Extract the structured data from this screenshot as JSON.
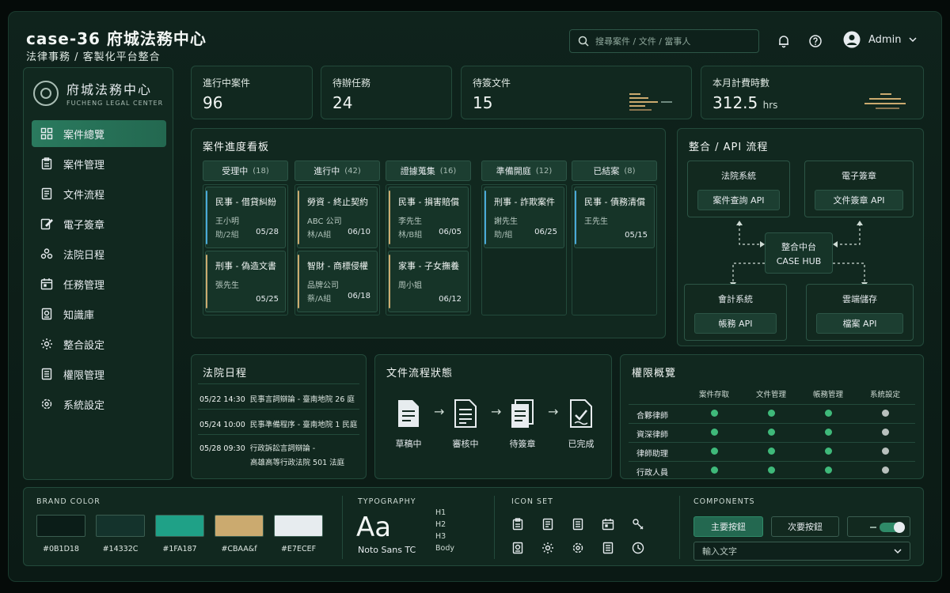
{
  "header": {
    "title": "case-36 府城法務中心",
    "subtitle": "法律事務 / 客製化平台整合",
    "search_placeholder": "搜尋案件 / 文件 / 當事人",
    "user_name": "Admin"
  },
  "sidebar": {
    "logo_name": "府城法務中心",
    "logo_en": "FUCHENG LEGAL CENTER",
    "items": [
      {
        "label": "案件總覽",
        "icon": "grid-icon",
        "active": true
      },
      {
        "label": "案件管理",
        "icon": "clipboard-icon",
        "active": false
      },
      {
        "label": "文件流程",
        "icon": "document-icon",
        "active": false
      },
      {
        "label": "電子簽章",
        "icon": "signature-icon",
        "active": false
      },
      {
        "label": "法院日程",
        "icon": "people-icon",
        "active": false
      },
      {
        "label": "任務管理",
        "icon": "calendar-icon",
        "active": false
      },
      {
        "label": "知識庫",
        "icon": "book-icon",
        "active": false
      },
      {
        "label": "整合設定",
        "icon": "gear-icon",
        "active": false
      },
      {
        "label": "權限管理",
        "icon": "list-icon",
        "active": false
      },
      {
        "label": "系統設定",
        "icon": "cog-icon",
        "active": false
      }
    ]
  },
  "stats": [
    {
      "label": "進行中案件",
      "value": "96",
      "unit": ""
    },
    {
      "label": "待辦任務",
      "value": "24",
      "unit": ""
    },
    {
      "label": "待簽文件",
      "value": "15",
      "unit": ""
    },
    {
      "label": "本月計費時數",
      "value": "312.5",
      "unit": "hrs"
    }
  ],
  "kanban": {
    "title": "案件進度看板",
    "columns": [
      {
        "name": "受理中",
        "count": "(18)",
        "cards": [
          {
            "title": "民事 - 借貸糾紛",
            "person": "王小明",
            "owner": "助/2組",
            "date": "05/28",
            "color": "#4aa8d8"
          },
          {
            "title": "刑事 - 偽造文書",
            "person": "張先生",
            "owner": "",
            "date": "05/25",
            "color": "#cbaa6f"
          }
        ]
      },
      {
        "name": "進行中",
        "count": "(42)",
        "cards": [
          {
            "title": "勞資 - 終止契約",
            "person": "ABC 公司",
            "owner": "林/A組",
            "date": "06/10",
            "color": "#cbaa6f"
          },
          {
            "title": "智財 - 商標侵權",
            "person": "品牌公司",
            "owner": "蔡/A組",
            "date": "06/18",
            "color": "#cbaa6f"
          }
        ]
      },
      {
        "name": "證據蒐集",
        "count": "(16)",
        "cards": [
          {
            "title": "民事 - 損害賠償",
            "person": "李先生",
            "owner": "林/B組",
            "date": "06/05",
            "color": "#cbaa6f"
          },
          {
            "title": "家事 - 子女撫養",
            "person": "周小姐",
            "owner": "",
            "date": "06/12",
            "color": "#cbaa6f"
          }
        ]
      },
      {
        "name": "準備開庭",
        "count": "(12)",
        "cards": [
          {
            "title": "刑事 - 詐欺案件",
            "person": "謝先生",
            "owner": "助/組",
            "date": "06/25",
            "color": "#4aa8d8"
          }
        ]
      },
      {
        "name": "已結案",
        "count": "(8)",
        "cards": [
          {
            "title": "民事 - 債務清償",
            "person": "王先生",
            "owner": "",
            "date": "05/15",
            "color": "#4aa8d8"
          }
        ]
      }
    ]
  },
  "integration": {
    "title": "整合 / API 流程",
    "hub_name": "整合中台",
    "hub_en": "CASE HUB",
    "systems": [
      {
        "name": "法院系統",
        "api": "案件查詢 API"
      },
      {
        "name": "電子簽章",
        "api": "文件簽章 API"
      },
      {
        "name": "會計系統",
        "api": "帳務 API"
      },
      {
        "name": "雲端儲存",
        "api": "檔案 API"
      }
    ]
  },
  "court": {
    "title": "法院日程",
    "events": [
      {
        "date": "05/22 14:30",
        "text": "民事言詞辯論 - 臺南地院 26 庭"
      },
      {
        "date": "05/24 10:00",
        "text": "民事準備程序 - 臺南地院 1 民庭"
      },
      {
        "date": "05/28 09:30",
        "text": "行政訴訟言詞辯論 -"
      },
      {
        "date": "",
        "text": "高雄高等行政法院 501 法庭"
      }
    ]
  },
  "doc_flow": {
    "title": "文件流程狀態",
    "steps": [
      "草稿中",
      "審核中",
      "待簽章",
      "已完成"
    ]
  },
  "permissions": {
    "title": "權限概覽",
    "columns": [
      "案件存取",
      "文件管理",
      "帳務管理",
      "系統設定"
    ],
    "rows": [
      {
        "role": "合夥律師",
        "values": [
          true,
          true,
          true,
          false
        ]
      },
      {
        "role": "資深律師",
        "values": [
          true,
          true,
          true,
          false
        ]
      },
      {
        "role": "律師助理",
        "values": [
          true,
          true,
          true,
          false
        ]
      },
      {
        "role": "行政人員",
        "values": [
          true,
          true,
          true,
          false
        ]
      }
    ],
    "on_color": "#3fb97a",
    "off_color": "#b8c0bd"
  },
  "design": {
    "brand_title": "BRAND COLOR",
    "colors": [
      {
        "hex": "#0B1D18",
        "label": "#0B1D18"
      },
      {
        "hex": "#14332C",
        "label": "#14332C"
      },
      {
        "hex": "#1FA187",
        "label": "#1FA187"
      },
      {
        "hex": "#CBAA6F",
        "label": "#CBAA&f"
      },
      {
        "hex": "#E7ECEF",
        "label": "#E7ECEF"
      }
    ],
    "typo_title": "TYPOGRAPHY",
    "typo_sample": "Aa",
    "typo_font": "Noto Sans TC",
    "typo_levels": [
      "H1",
      "H2",
      "H3",
      "Body"
    ],
    "icon_title": "ICON SET",
    "comp_title": "COMPONENTS",
    "primary_button": "主要按鈕",
    "secondary_button": "次要按鈕",
    "input_placeholder": "輸入文字"
  }
}
